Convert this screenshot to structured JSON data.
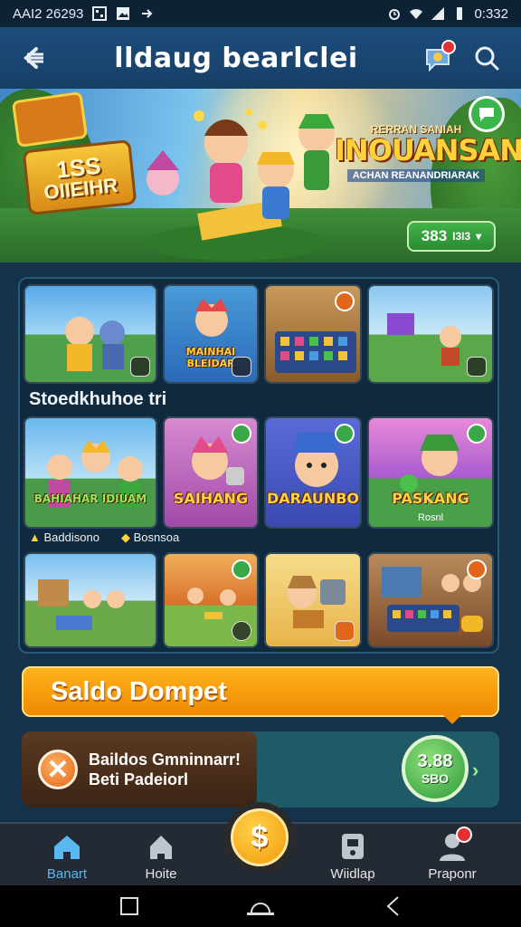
{
  "status_bar": {
    "left_text": "AAI2 26293",
    "time": "0:332"
  },
  "app_bar": {
    "title": "lldaug bearlclei"
  },
  "banner": {
    "logo_line1": "1SS",
    "logo_line2": "OIIEIHR",
    "headline_small": "RERRAN SANIAH",
    "headline": "INOUANSAN",
    "headline_sub": "ACHAN REANANDRIARAK",
    "chip_value": "383",
    "chip_unit": "I3I3"
  },
  "games": {
    "section_label": "Stoedkhuhoe tri",
    "tiles": [
      {
        "title": "",
        "caption": ""
      },
      {
        "title": "MAINHAI BLEIDAR",
        "caption": ""
      },
      {
        "title": "",
        "caption": ""
      },
      {
        "title": "",
        "caption": ""
      },
      {
        "title": "BAHIAHAR IDIUAM",
        "caption": "Baddisono"
      },
      {
        "title": "SAIHANG",
        "caption": "Bosnsoa"
      },
      {
        "title": "DARAUNBO",
        "caption": ""
      },
      {
        "title": "PASKANG",
        "caption": "Rosnl"
      },
      {
        "title": "",
        "caption": ""
      },
      {
        "title": "",
        "caption": ""
      },
      {
        "title": "",
        "caption": ""
      },
      {
        "title": "",
        "caption": ""
      }
    ]
  },
  "wallet": {
    "saldo_label": "Saldo Dompet",
    "message_line1": "Baildos Gmninnarr!",
    "message_line2": "Beti Padeiorl",
    "balance_value": "3.88",
    "balance_sub": "SBO"
  },
  "bottom_nav": {
    "items": [
      {
        "label": "Banart"
      },
      {
        "label": "Hoite"
      },
      {
        "label": "Wiidlap"
      },
      {
        "label": "Praponr"
      }
    ],
    "center_symbol": "$"
  },
  "colors": {
    "app_bar": "#1c4d7c",
    "accent_orange": "#ef8a00",
    "accent_green": "#39b54a",
    "nav_active": "#5ab8f0"
  }
}
